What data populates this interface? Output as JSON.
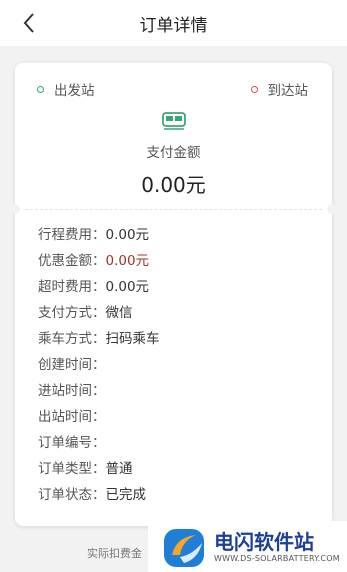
{
  "header": {
    "title": "订单详情"
  },
  "stations": {
    "start": "出发站",
    "end": "到达站"
  },
  "payment": {
    "label": "支付金额",
    "amount": "0.00元"
  },
  "rows": [
    {
      "label": "行程费用：",
      "value": "0.00元"
    },
    {
      "label": "优惠金额：",
      "value": "0.00元"
    },
    {
      "label": "超时费用：",
      "value": "0.00元"
    },
    {
      "label": "支付方式：",
      "value": "微信"
    },
    {
      "label": "乘车方式：",
      "value": "扫码乘车"
    },
    {
      "label": "创建时间：",
      "value": ""
    },
    {
      "label": "进站时间：",
      "value": ""
    },
    {
      "label": "出站时间：",
      "value": ""
    },
    {
      "label": "订单编号：",
      "value": ""
    },
    {
      "label": "订单类型：",
      "value": "普通"
    },
    {
      "label": "订单状态：",
      "value": "已完成"
    }
  ],
  "footer": {
    "text": "实际扣费金"
  },
  "watermark": {
    "title": "电闪软件站",
    "subtitle": "WWW.DS-SOLARBATTERY.COM"
  },
  "colors": {
    "green": "#3aa676",
    "red": "#d9534f",
    "discount": "#a0342f",
    "brand": "#1d3f9a"
  },
  "icons": {
    "back": "chevron-left-icon",
    "train": "train-icon"
  }
}
